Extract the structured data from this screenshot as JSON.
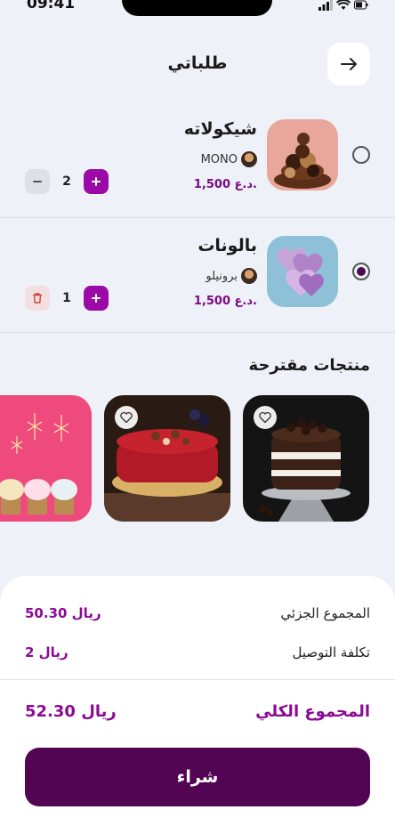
{
  "status_bar": {
    "time": "09:41",
    "icons": [
      "signal-icon",
      "wifi-icon",
      "battery-icon"
    ]
  },
  "header": {
    "title": "طلباتي",
    "back_icon": "arrow-right-icon"
  },
  "cart": {
    "items": [
      {
        "title": "شيكولاته",
        "seller": "MONO",
        "price": "1,500 د.ع.",
        "quantity": "2",
        "selected": false,
        "decrement_icon": "minus-icon"
      },
      {
        "title": "بالونات",
        "seller": "برونيلو",
        "price": "1,500 د.ع.",
        "quantity": "1",
        "selected": true,
        "decrement_icon": "trash-icon"
      }
    ]
  },
  "suggested": {
    "title": "منتجات مقترحة",
    "products": [
      {
        "favorite_icon": "heart-icon"
      },
      {
        "favorite_icon": "heart-icon"
      },
      {
        "favorite_icon": "heart-icon"
      }
    ]
  },
  "summary": {
    "subtotal_label": "المجموع الجزئي",
    "subtotal_value": "50.30 ريال",
    "delivery_label": "تكلفة التوصيل",
    "delivery_value": "2 ريال",
    "total_label": "المجموع الكلي",
    "total_value": "52.30 ريال",
    "buy_label": "شراء"
  },
  "colors": {
    "accent": "#9b0aa6",
    "primary_button": "#520552",
    "price": "#7a0a86",
    "background": "#eef1f7"
  }
}
